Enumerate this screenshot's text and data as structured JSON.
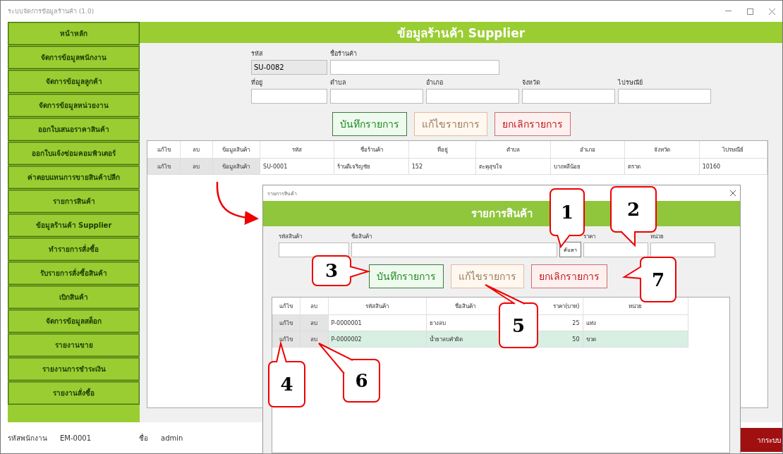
{
  "window": {
    "title": "ระบบจัดการข้อมูลร้านค้า (1.0)"
  },
  "sidebar": {
    "items": [
      {
        "label": "หน้าหลัก"
      },
      {
        "label": "จัดการข้อมูลพนักงาน"
      },
      {
        "label": "จัดการข้อมูลลูกค้า"
      },
      {
        "label": "จัดการข้อมูลหน่วยงาน"
      },
      {
        "label": "ออกใบเสนอราคาสินค้า"
      },
      {
        "label": "ออกใบแจ้งซ่อมคอมพิวเตอร์"
      },
      {
        "label": "ค่าตอบแทนการขายสินค้าปลีก"
      },
      {
        "label": "รายการสินค้า"
      },
      {
        "label": "ข้อมูลร้านค้า Supplier"
      },
      {
        "label": "ทำรายการสั่งซื้อ"
      },
      {
        "label": "รับรายการสั่งซื้อสินค้า"
      },
      {
        "label": "เบิกสินค้า"
      },
      {
        "label": "จัดการข้อมูลสต็อก"
      },
      {
        "label": "รายงานขาย"
      },
      {
        "label": "รายงานการชำระเงิน"
      },
      {
        "label": "รายงานสั่งซื้อ"
      }
    ]
  },
  "header": {
    "title": "ข้อมูลร้านค้า Supplier"
  },
  "form": {
    "fields": [
      {
        "label": "รหัส",
        "value": "SU-0082",
        "disabled": true
      },
      {
        "label": "ชื่อร้านค้า",
        "disabled": false
      },
      {
        "label": "ที่อยู่",
        "disabled": false
      },
      {
        "label": "ตำบล",
        "disabled": false
      },
      {
        "label": "อำเภอ",
        "disabled": false
      },
      {
        "label": "จังหวัด",
        "disabled": false
      },
      {
        "label": "ไปรษณีย์",
        "disabled": false
      }
    ]
  },
  "buttons": [
    {
      "label": "บันทึกรายการ",
      "kind": "save"
    },
    {
      "label": "แก้ไขรายการ",
      "kind": "edit"
    },
    {
      "label": "ยกเลิกรายการ",
      "kind": "cancel"
    }
  ],
  "table": {
    "columns": [
      {
        "label": "แก้ไข",
        "kind": "button"
      },
      {
        "label": "ลบ",
        "kind": "button"
      },
      {
        "label": "ข้อมูลสินค้า",
        "kind": "button"
      },
      {
        "label": "รหัส",
        "kind": "text"
      },
      {
        "label": "ชื่อร้านค้า",
        "kind": "text"
      },
      {
        "label": "ที่อยู่",
        "kind": "text"
      },
      {
        "label": "ตำบล",
        "kind": "text"
      },
      {
        "label": "อำเภอ",
        "kind": "text"
      },
      {
        "label": "จังหวัด",
        "kind": "text"
      },
      {
        "label": "ไปรษณีย์",
        "kind": "text"
      }
    ],
    "rows": [
      {
        "selected": false,
        "cells": [
          "แก้ไข",
          "ลบ",
          "ข้อมูลสินค้า",
          "SU-0001",
          "ร้านดีเจริญชัย",
          "152",
          "ตะคุสุขใจ",
          "บางพลีน้อย",
          "ตราด",
          "10160"
        ]
      }
    ]
  },
  "footer": {
    "employee_label": "รหัสพนักงาน",
    "employee_id": "EM-0001",
    "name_label": "ชื่อ",
    "name": "admin",
    "logout_button": "ากระบบ"
  },
  "dialog": {
    "title": "รายการสินค้า",
    "header": "รายการสินค้า",
    "fields": [
      {
        "label": "รหัสสินค้า"
      },
      {
        "label": "ชื่อสินค้า"
      },
      {
        "label": "ราคา"
      },
      {
        "label": "หน่วย"
      }
    ],
    "search_button": "ค้นหา",
    "buttons": [
      {
        "label": "บันทึกรายการ",
        "kind": "save"
      },
      {
        "label": "แก้ไขรายการ",
        "kind": "edit"
      },
      {
        "label": "ยกเลิกรายการ",
        "kind": "cancel"
      }
    ],
    "table": {
      "columns": [
        {
          "label": "แก้ไข",
          "kind": "button"
        },
        {
          "label": "ลบ",
          "kind": "button"
        },
        {
          "label": "รหัสสินค้า",
          "kind": "text"
        },
        {
          "label": "ชื่อสินค้า",
          "kind": "text"
        },
        {
          "label": "ราคา(บาท)",
          "kind": "number"
        },
        {
          "label": "หน่วย",
          "kind": "text"
        }
      ],
      "rows": [
        {
          "selected": false,
          "cells": [
            "แก้ไข",
            "ลบ",
            "P-0000001",
            "ยางลบ",
            "25",
            "แท่ง"
          ]
        },
        {
          "selected": true,
          "cells": [
            "แก้ไข",
            "ลบ",
            "P-0000002",
            "น้ำยาลบคำผิด",
            "50",
            "ขวด"
          ]
        }
      ]
    }
  },
  "annotations": [
    {
      "number": "1"
    },
    {
      "number": "2"
    },
    {
      "number": "3"
    },
    {
      "number": "4"
    },
    {
      "number": "5"
    },
    {
      "number": "6"
    },
    {
      "number": "7"
    }
  ]
}
